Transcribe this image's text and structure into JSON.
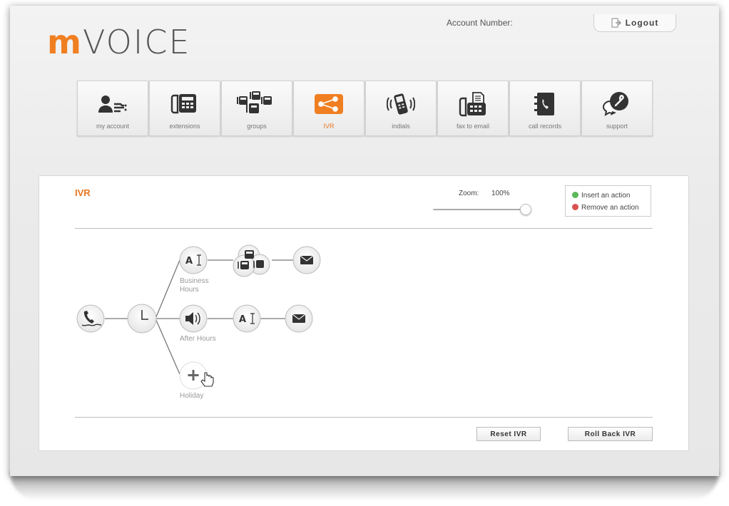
{
  "header": {
    "logo_m": "m",
    "logo_rest": "VOICE",
    "account_label": "Account Number:",
    "logout_label": "Logout"
  },
  "nav": [
    {
      "label": "my account",
      "icon": "user-icon"
    },
    {
      "label": "extensions",
      "icon": "desk-phone-icon"
    },
    {
      "label": "groups",
      "icon": "phone-group-icon"
    },
    {
      "label": "IVR",
      "icon": "ivr-flow-icon",
      "active": true
    },
    {
      "label": "indials",
      "icon": "ringing-mobile-icon"
    },
    {
      "label": "fax to email",
      "icon": "fax-icon"
    },
    {
      "label": "call records",
      "icon": "phone-book-icon"
    },
    {
      "label": "support",
      "icon": "support-chat-icon"
    }
  ],
  "panel": {
    "title": "IVR",
    "zoom_label": "Zoom:",
    "zoom_value": "100%",
    "zoom_level": 0.95,
    "legend": {
      "insert_label": "Insert an action",
      "remove_label": "Remove an action",
      "insert_color": "#5cb85c",
      "remove_color": "#d9534f"
    },
    "branches": {
      "business": [
        "Business",
        "Hours"
      ],
      "after": "After Hours",
      "holiday": "Holiday"
    },
    "reset_label": "Reset IVR",
    "rollback_label": "Roll Back IVR"
  },
  "colors": {
    "accent": "#e8751d"
  }
}
